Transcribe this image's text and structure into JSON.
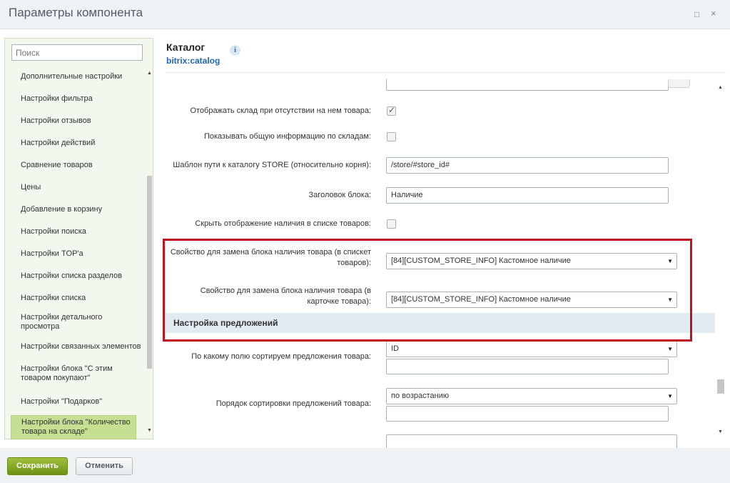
{
  "window": {
    "title": "Параметры компонента",
    "maximize_icon": "□",
    "close_icon": "×"
  },
  "sidebar": {
    "search_placeholder": "Поиск",
    "items": [
      {
        "label": "Дополнительные настройки"
      },
      {
        "label": "Настройки фильтра"
      },
      {
        "label": "Настройки отзывов"
      },
      {
        "label": "Настройки действий"
      },
      {
        "label": "Сравнение товаров"
      },
      {
        "label": "Цены"
      },
      {
        "label": "Добавление в корзину"
      },
      {
        "label": "Настройки поиска"
      },
      {
        "label": "Настройки TOP'а"
      },
      {
        "label": "Настройки списка разделов"
      },
      {
        "label": "Настройки списка"
      },
      {
        "label": "Настройки детального просмотра"
      },
      {
        "label": "Настройки связанных элементов"
      },
      {
        "label": "Настройки блока \"С этим товаром покупают\""
      },
      {
        "label": "Настройки \"Подарков\""
      },
      {
        "label": "Настройки блока \"Количество товара на складе\"",
        "active": true
      }
    ]
  },
  "header": {
    "title": "Каталог",
    "subtitle": "bitrix:catalog",
    "info_icon": "i"
  },
  "form": {
    "show_store_empty": {
      "label": "Отображать склад при отсутствии на нем товара:",
      "checked": true
    },
    "show_general_info": {
      "label": "Показывать общую информацию по складам:",
      "checked": false
    },
    "store_path": {
      "label": "Шаблон пути к каталогу STORE (относительно корня):",
      "value": "/store/#store_id#"
    },
    "block_title": {
      "label": "Заголовок блока:",
      "value": "Наличие"
    },
    "hide_in_list": {
      "label": "Скрыть отображение наличия в списке товаров:",
      "checked": false
    },
    "prop_list": {
      "label": "Свойство для замена блока наличия товара (в спискет товаров):",
      "value": "[84][CUSTOM_STORE_INFO] Кастомное наличие"
    },
    "prop_card": {
      "label": "Свойство для замена блока наличия товара (в карточке товара):",
      "value": "[84][CUSTOM_STORE_INFO] Кастомное наличие"
    },
    "offers_section": "Настройка предложений",
    "sort_field": {
      "label": "По какому полю сортируем предложения товара:",
      "value": "ID"
    },
    "sort_order": {
      "label": "Порядок сортировки предложений товара:",
      "value": "по возрастанию"
    }
  },
  "footer": {
    "save": "Сохранить",
    "cancel": "Отменить"
  }
}
